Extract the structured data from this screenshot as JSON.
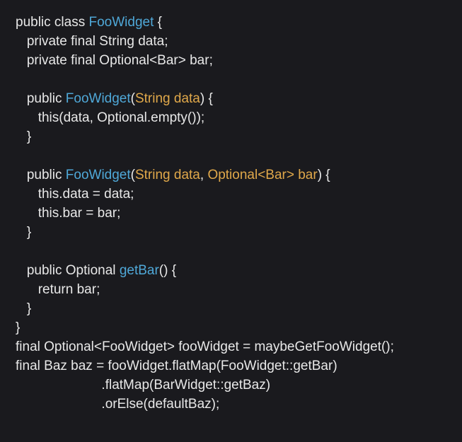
{
  "code": {
    "l1": {
      "a": "public class ",
      "b": "FooWidget",
      "c": " {"
    },
    "l2": {
      "a": "private final ",
      "b": "String data;"
    },
    "l3": {
      "a": "private final ",
      "b": "Optional<Bar> bar;"
    },
    "l4": "",
    "l5": {
      "a": "public ",
      "b": "FooWidget",
      "c": "(",
      "d": "String data",
      "e": ") {"
    },
    "l6": {
      "a": "this",
      "b": "(data, Optional.empty());"
    },
    "l7": "}",
    "l8": "",
    "l9": {
      "a": "public ",
      "b": "FooWidget",
      "c": "(",
      "d": "String data",
      "e": ", ",
      "f": "Optional<Bar> bar",
      "g": ") {"
    },
    "l10": {
      "a": "this",
      "b": ".data = data;"
    },
    "l11": {
      "a": "this",
      "b": ".bar = bar;"
    },
    "l12": "}",
    "l13": "",
    "l14": {
      "a": "public ",
      "b": "Optional ",
      "c": "getBar",
      "d": "() {"
    },
    "l15": {
      "a": "return ",
      "b": "bar;"
    },
    "l16": "}",
    "l17": "}",
    "l18": {
      "a": "final ",
      "b": "Optional<FooWidget> fooWidget = maybeGetFooWidget();"
    },
    "l19": {
      "a": "final ",
      "b": "Baz baz = fooWidget.flatMap(FooWidget::getBar)"
    },
    "l20": ".flatMap(BarWidget::getBaz)",
    "l21": ".orElse(defaultBaz);"
  }
}
